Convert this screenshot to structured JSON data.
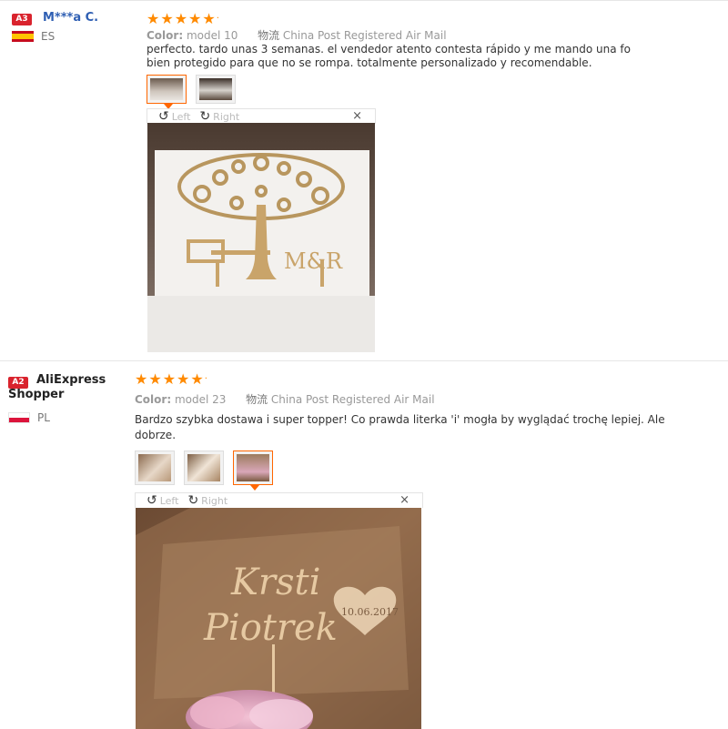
{
  "reviews": [
    {
      "badge": "A3",
      "name": "M***a C.",
      "country_code": "ES",
      "stars": 5,
      "color_label": "Color:",
      "color_value": "model 10",
      "shipping_label": "物流",
      "shipping_value": "China Post Registered Air Mail",
      "text_line1": "perfecto. tardo unas 3 semanas. el vendedor atento contesta rápido y me mando una fo",
      "text_line2": "bien protegido para que no se rompa. totalmente personalizado y recomendable.",
      "viewer": {
        "left": "Left",
        "right": "Right",
        "close": "×"
      },
      "photo_text": "M&R"
    },
    {
      "badge": "A2",
      "name_line1": "AliExpress",
      "name_line2": "Shopper",
      "country_code": "PL",
      "stars": 5,
      "color_label": "Color:",
      "color_value": "model 23",
      "shipping_label": "物流",
      "shipping_value": "China Post Registered Air Mail",
      "text_line1": "Bardzo szybka dostawa i super topper! Co prawda literka 'i' mogła by wyglądać trochę lepiej. Ale",
      "text_line2": "dobrze.",
      "viewer": {
        "left": "Left",
        "right": "Right",
        "close": "×"
      },
      "photo_name1": "Krsti",
      "photo_name2": "Piotrek",
      "photo_date": "10.06.2017"
    }
  ],
  "colors": {
    "accent": "#ff6600",
    "star": "#ff8a00",
    "badge": "#d9232d"
  }
}
